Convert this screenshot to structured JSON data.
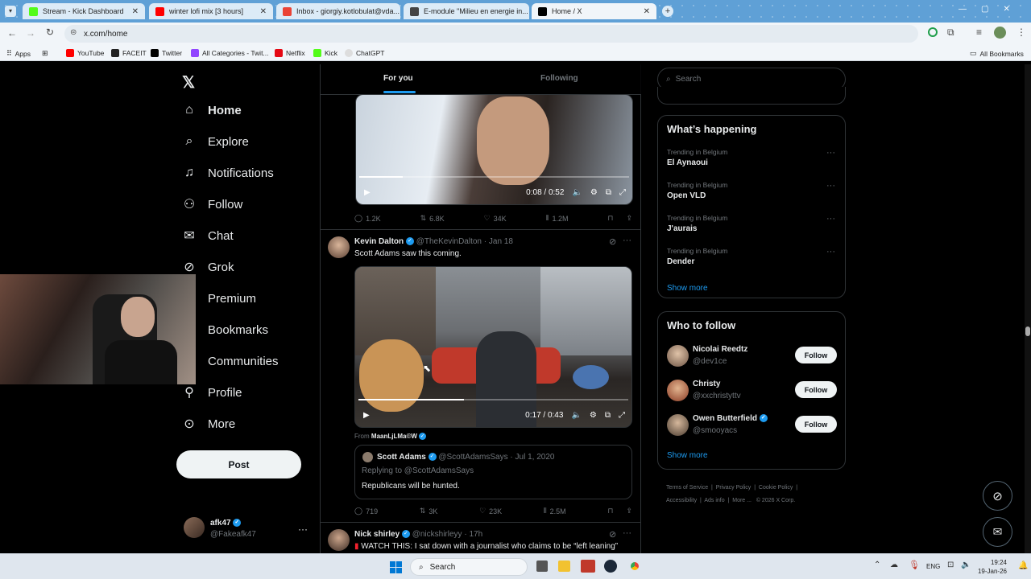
{
  "browser": {
    "tabs": [
      {
        "title": "Stream - Kick Dashboard",
        "color": "#53fc18"
      },
      {
        "title": "winter lofi mix [3 hours]",
        "color": "#ff0000"
      },
      {
        "title": "Inbox - giorgiy.kotlobulat@vda...",
        "color": "#ea4335"
      },
      {
        "title": "E-module \"Milieu en energie in...",
        "color": "#444444"
      },
      {
        "title": "Home / X",
        "color": "#000000"
      }
    ],
    "url": "x.com/home",
    "bookmarks": [
      "Apps",
      "YouTube",
      "FACEIT",
      "Twitter",
      "All Categories - Twit...",
      "Netflix",
      "Kick",
      "ChatGPT"
    ],
    "all_bookmarks": "All Bookmarks"
  },
  "nav": {
    "items": [
      "Home",
      "Explore",
      "Notifications",
      "Follow",
      "Chat",
      "Grok",
      "Premium",
      "Bookmarks",
      "Communities",
      "Profile",
      "More"
    ],
    "post": "Post",
    "account": {
      "name": "afk47",
      "handle": "@Fakeafk47"
    }
  },
  "feed": {
    "tabs": [
      "For you",
      "Following"
    ],
    "post1": {
      "time": "0:08 / 0:52",
      "replies": "1.2K",
      "reposts": "6.8K",
      "likes": "34K",
      "views": "1.2M"
    },
    "post2": {
      "author": "Kevin Dalton",
      "handle": "@TheKevinDalton",
      "date": "Jan 18",
      "text": "Scott Adams saw this coming.",
      "time": "0:17 / 0:43",
      "from": "From",
      "from_name": "MaanLjLMa©W",
      "quote": {
        "author": "Scott Adams",
        "handle": "@ScottAdamsSays",
        "date": "Jul 1, 2020",
        "replying": "Replying to @ScottAdamsSays",
        "text": "Republicans will be hunted."
      },
      "replies": "719",
      "reposts": "3K",
      "likes": "23K",
      "views": "2.5M"
    },
    "post3": {
      "author": "Nick shirley",
      "handle": "@nickshirleyy",
      "date": "17h",
      "text": "WATCH THIS: I sat down with a journalist who claims to be “left leaning”"
    }
  },
  "search": {
    "placeholder": "Search"
  },
  "trending": {
    "title": "What’s happening",
    "items": [
      {
        "meta": "Trending in Belgium",
        "name": "El Aynaoui"
      },
      {
        "meta": "Trending in Belgium",
        "name": "Open VLD"
      },
      {
        "meta": "Trending in Belgium",
        "name": "J'aurais"
      },
      {
        "meta": "Trending in Belgium",
        "name": "Dender"
      }
    ],
    "show_more": "Show more"
  },
  "who_to_follow": {
    "title": "Who to follow",
    "users": [
      {
        "name": "Nicolai Reedtz",
        "handle": "@dev1ce",
        "verified": false
      },
      {
        "name": "Christy",
        "handle": "@xxchristyttv",
        "verified": false
      },
      {
        "name": "Owen Butterfield",
        "handle": "@smooyacs",
        "verified": true
      }
    ],
    "follow": "Follow",
    "show_more": "Show more"
  },
  "footer": {
    "links": [
      "Terms of Service",
      "Privacy Policy",
      "Cookie Policy",
      "Accessibility",
      "Ads info",
      "More ...",
      "© 2026 X Corp."
    ]
  },
  "taskbar": {
    "search": "Search",
    "lang": "ENG",
    "time": "19:24",
    "date": "19-Jan-26"
  }
}
